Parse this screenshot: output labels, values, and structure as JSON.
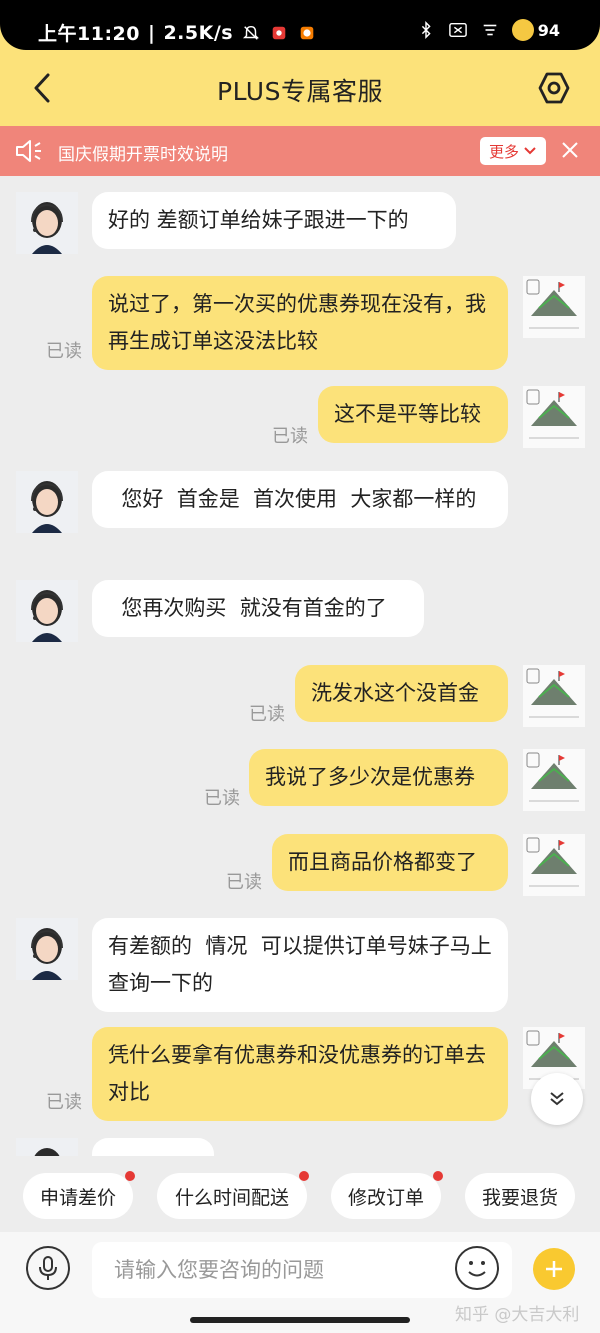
{
  "status_bar": {
    "time": "上午11:20",
    "speed": "2.5K/s",
    "battery": "94"
  },
  "nav": {
    "title": "PLUS专属客服"
  },
  "notice": {
    "text": "国庆假期开票时效说明",
    "more_label": "更多"
  },
  "messages": [
    {
      "side": "left",
      "text": "好的  差额订单给妹子跟进一下的"
    },
    {
      "side": "right",
      "text": "说过了，第一次买的优惠券现在没有，我再生成订单这没法比较",
      "read": "已读"
    },
    {
      "side": "right",
      "text": "这不是平等比较",
      "read": "已读"
    },
    {
      "side": "left",
      "text": "  您好  首金是  首次使用  大家都一样的"
    },
    {
      "side": "left",
      "text": "  您再次购买  就没有首金的了"
    },
    {
      "side": "right",
      "text": "洗发水这个没首金",
      "read": "已读"
    },
    {
      "side": "right",
      "text": "我说了多少次是优惠券",
      "read": "已读"
    },
    {
      "side": "right",
      "text": "而且商品价格都变了",
      "read": "已读"
    },
    {
      "side": "left",
      "text": "有差额的  情况  可以提供订单号妹子马上查询一下的"
    },
    {
      "side": "right",
      "text": "凭什么要拿有优惠券和没优惠券的订单去对比",
      "read": "已读"
    }
  ],
  "quick_replies": [
    {
      "label": "申请差价",
      "dot": true
    },
    {
      "label": "什么时间配送",
      "dot": true
    },
    {
      "label": "修改订单",
      "dot": true
    },
    {
      "label": "我要退货",
      "dot": false
    }
  ],
  "input": {
    "placeholder": "请输入您要咨询的问题"
  },
  "watermark": "知乎 @大吉大利",
  "colors": {
    "accent": "#fce27a",
    "notice": "#f0857a",
    "dot": "#e53935",
    "add_button": "#f9c930"
  }
}
